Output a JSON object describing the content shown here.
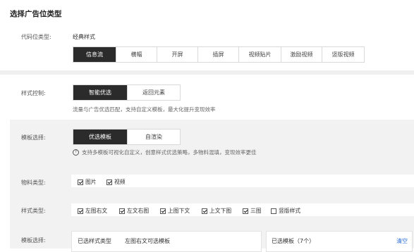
{
  "section": {
    "title": "选择广告位类型",
    "ad_slot_label": "代码位类型:",
    "ad_slot_value": "经典样式",
    "ad_slot_tabs": [
      "信息流",
      "横幅",
      "开屏",
      "插屏",
      "视频贴片",
      "激励视频",
      "竖版视频"
    ],
    "ad_slot_active": "信息流"
  },
  "style_control": {
    "label": "样式控制:",
    "options": [
      "智能优选",
      "返回元素"
    ],
    "active": "智能优选",
    "hint": "流量与广告优选匹配，支持自定义模板，最大化提升变现效率"
  },
  "template_select": {
    "label": "模板选择:",
    "options": [
      "优选模板",
      "自渲染"
    ],
    "active": "优选模板",
    "hint": "支持多模板可视化自定义，创意样式优选策略，多物料混填，变现效率更佳"
  },
  "material": {
    "label": "物料类型:",
    "items": [
      {
        "label": "图片",
        "checked": true
      },
      {
        "label": "视频",
        "checked": true
      }
    ]
  },
  "style_type": {
    "label": "样式类型:",
    "items": [
      {
        "label": "左图右文",
        "checked": true
      },
      {
        "label": "左文右图",
        "checked": true
      },
      {
        "label": "上图下文",
        "checked": true
      },
      {
        "label": "上文下图",
        "checked": true
      },
      {
        "label": "三图",
        "checked": true
      },
      {
        "label": "竖版样式",
        "checked": false
      }
    ]
  },
  "template_choose": {
    "label": "模板选择:",
    "selected_type_label": "已选样式类型",
    "selected_type_value": "左图右文可选模板",
    "selected_templates_label": "已选模板（7个）",
    "clear_label": "清空"
  },
  "colors": {
    "active_bg": "#2b2b2b",
    "panel_bg": "#f2f2f2",
    "link": "#2f6fd8"
  }
}
